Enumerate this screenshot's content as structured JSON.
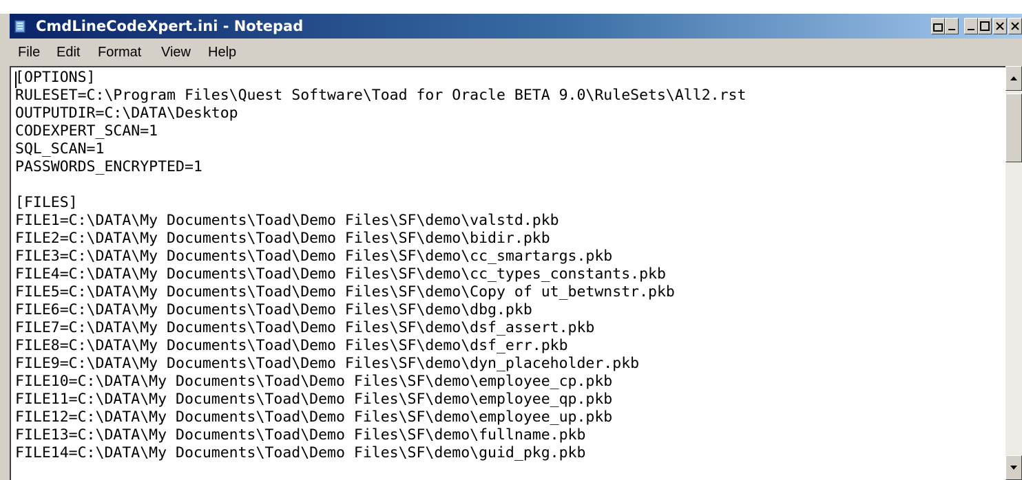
{
  "window": {
    "title": "CmdLineCodeXpert.ini - Notepad",
    "app_icon": "notepad-icon",
    "title_gradient": [
      "#0a246a",
      "#a6caf0"
    ]
  },
  "caption_buttons": [
    {
      "name": "minimize-button",
      "icon": "minimize-icon"
    },
    {
      "name": "maximize-button",
      "icon": "maximize-icon"
    },
    {
      "name": "close-button",
      "icon": "close-icon"
    }
  ],
  "menu": {
    "items": [
      {
        "label": "File"
      },
      {
        "label": "Edit"
      },
      {
        "label": "Format"
      },
      {
        "label": "View"
      },
      {
        "label": "Help"
      }
    ]
  },
  "document": {
    "lines": [
      "[OPTIONS]",
      "RULESET=C:\\Program Files\\Quest Software\\Toad for Oracle BETA 9.0\\RuleSets\\All2.rst",
      "OUTPUTDIR=C:\\DATA\\Desktop",
      "CODEXPERT_SCAN=1",
      "SQL_SCAN=1",
      "PASSWORDS_ENCRYPTED=1",
      "",
      "[FILES]",
      "FILE1=C:\\DATA\\My Documents\\Toad\\Demo Files\\SF\\demo\\valstd.pkb",
      "FILE2=C:\\DATA\\My Documents\\Toad\\Demo Files\\SF\\demo\\bidir.pkb",
      "FILE3=C:\\DATA\\My Documents\\Toad\\Demo Files\\SF\\demo\\cc_smartargs.pkb",
      "FILE4=C:\\DATA\\My Documents\\Toad\\Demo Files\\SF\\demo\\cc_types_constants.pkb",
      "FILE5=C:\\DATA\\My Documents\\Toad\\Demo Files\\SF\\demo\\Copy of ut_betwnstr.pkb",
      "FILE6=C:\\DATA\\My Documents\\Toad\\Demo Files\\SF\\demo\\dbg.pkb",
      "FILE7=C:\\DATA\\My Documents\\Toad\\Demo Files\\SF\\demo\\dsf_assert.pkb",
      "FILE8=C:\\DATA\\My Documents\\Toad\\Demo Files\\SF\\demo\\dsf_err.pkb",
      "FILE9=C:\\DATA\\My Documents\\Toad\\Demo Files\\SF\\demo\\dyn_placeholder.pkb",
      "FILE10=C:\\DATA\\My Documents\\Toad\\Demo Files\\SF\\demo\\employee_cp.pkb",
      "FILE11=C:\\DATA\\My Documents\\Toad\\Demo Files\\SF\\demo\\employee_qp.pkb",
      "FILE12=C:\\DATA\\My Documents\\Toad\\Demo Files\\SF\\demo\\employee_up.pkb",
      "FILE13=C:\\DATA\\My Documents\\Toad\\Demo Files\\SF\\demo\\fullname.pkb",
      "FILE14=C:\\DATA\\My Documents\\Toad\\Demo Files\\SF\\demo\\guid_pkg.pkb"
    ]
  },
  "scrollbar": {
    "up_icon": "scroll-up-arrow-icon",
    "down_icon": "scroll-down-arrow-icon"
  }
}
